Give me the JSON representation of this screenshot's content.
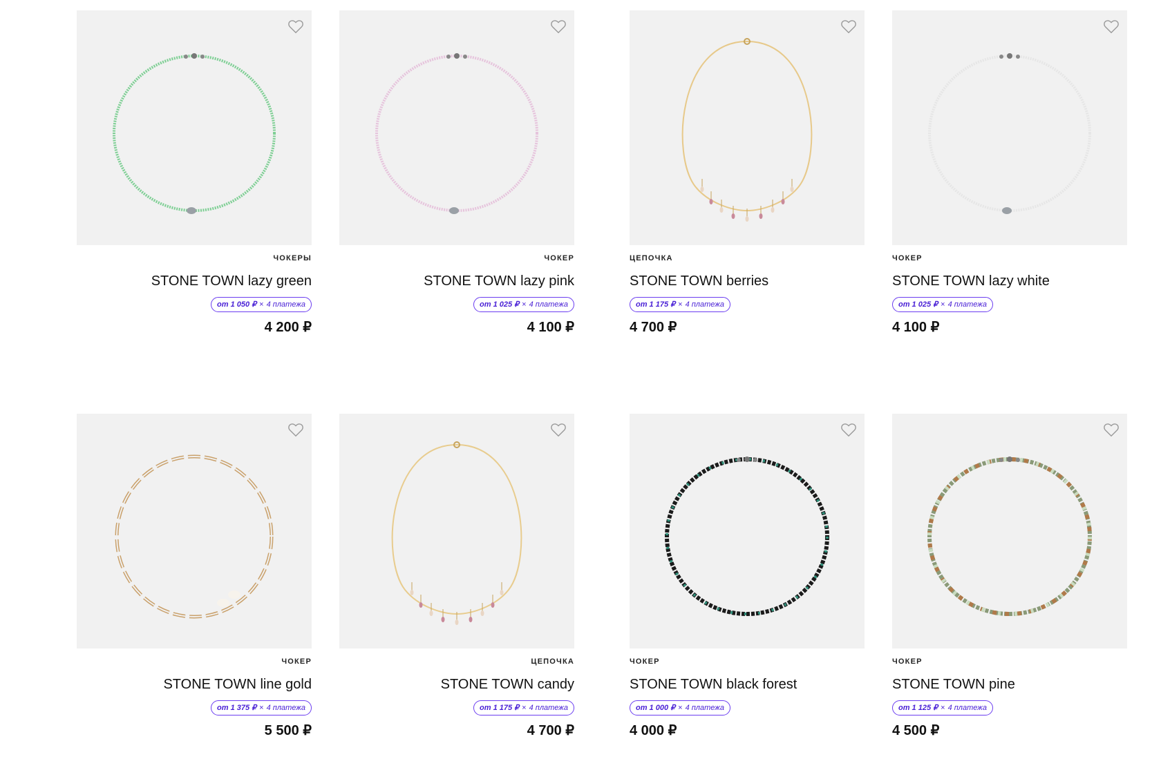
{
  "accent": "#5b2ee6",
  "products": [
    {
      "category": "ЧОКЕРЫ",
      "title": "STONE TOWN lazy green",
      "installment": "от 1 050 ₽",
      "times": "×",
      "payments": "4 платежа",
      "price": "4 200 ₽",
      "style": "beads",
      "color": "#7ecf94",
      "align": "right"
    },
    {
      "category": "ЧОКЕР",
      "title": "STONE TOWN lazy pink",
      "installment": "от 1 025 ₽",
      "times": "×",
      "payments": "4 платежа",
      "price": "4 100 ₽",
      "style": "beads",
      "color": "#e6c3dc",
      "align": "right"
    },
    {
      "category": "ЦЕПОЧКА",
      "title": "STONE TOWN berries",
      "installment": "от 1 175 ₽",
      "times": "×",
      "payments": "4 платежа",
      "price": "4 700 ₽",
      "style": "chain",
      "color": "#e7c98a",
      "align": "left"
    },
    {
      "category": "ЧОКЕР",
      "title": "STONE TOWN lazy white",
      "installment": "от 1 025 ₽",
      "times": "×",
      "payments": "4 платежа",
      "price": "4 100 ₽",
      "style": "beads",
      "color": "#e6e6e6",
      "align": "left"
    },
    {
      "category": "ЧОКЕР",
      "title": "STONE TOWN line gold",
      "installment": "от 1 375 ₽",
      "times": "×",
      "payments": "4 платежа",
      "price": "5 500 ₽",
      "style": "links",
      "color": "#c9a06a",
      "align": "right"
    },
    {
      "category": "ЦЕПОЧКА",
      "title": "STONE TOWN candy",
      "installment": "от 1 175 ₽",
      "times": "×",
      "payments": "4 платежа",
      "price": "4 700 ₽",
      "style": "chain",
      "color": "#e8cc8e",
      "align": "right"
    },
    {
      "category": "ЧОКЕР",
      "title": "STONE TOWN black forest",
      "installment": "от 1 000 ₽",
      "times": "×",
      "payments": "4 платежа",
      "price": "4 000 ₽",
      "style": "dark",
      "color": "#1b1b1b",
      "align": "left"
    },
    {
      "category": "ЧОКЕР",
      "title": "STONE TOWN pine",
      "installment": "от 1 125 ₽",
      "times": "×",
      "payments": "4 платежа",
      "price": "4 500 ₽",
      "style": "mixed",
      "color": "#8a9a78",
      "align": "left"
    }
  ]
}
